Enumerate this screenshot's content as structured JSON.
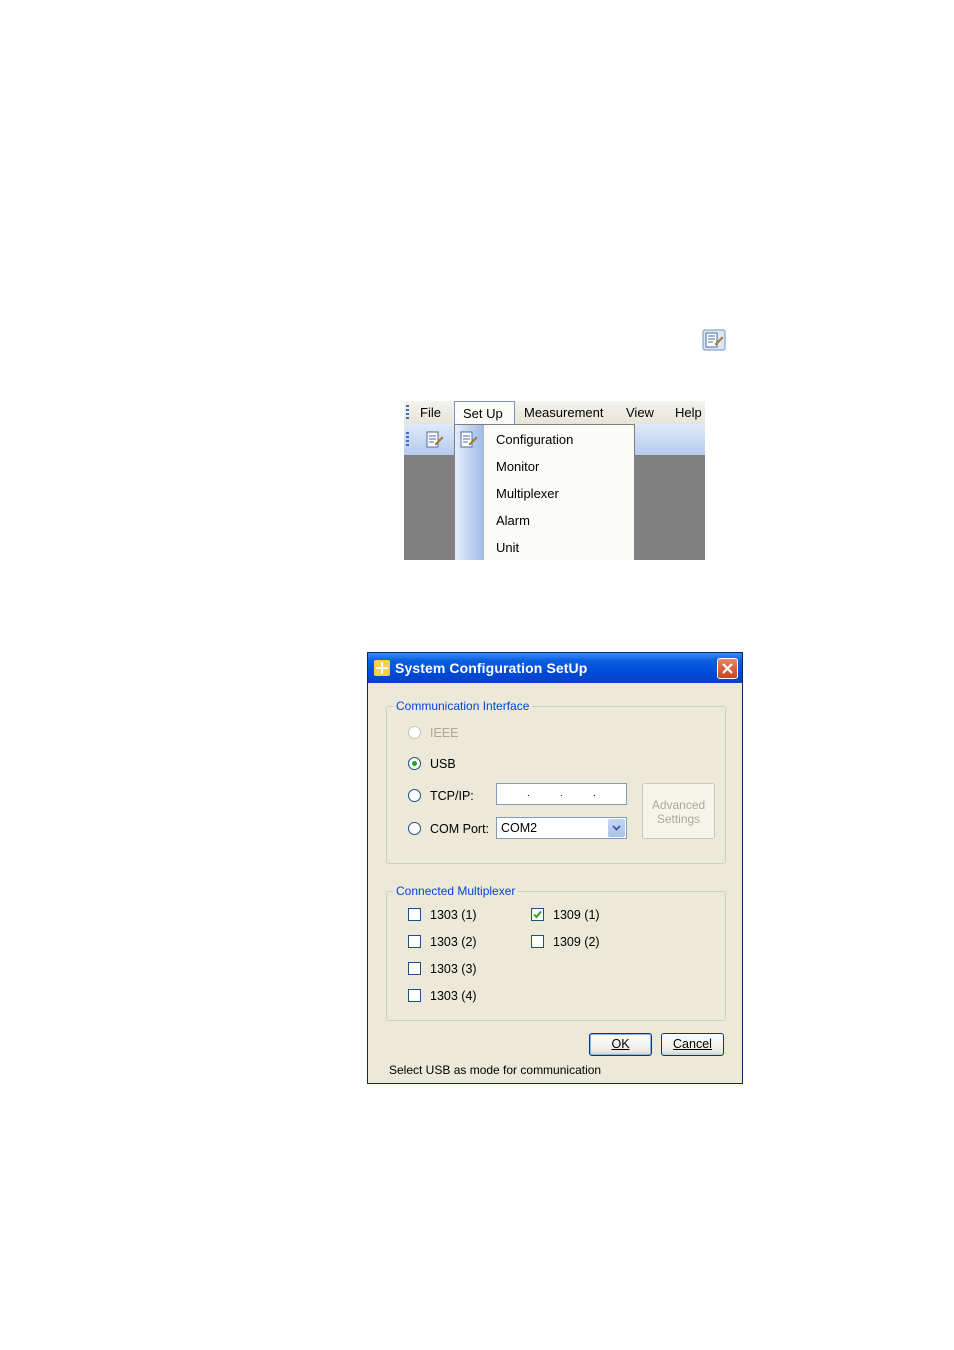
{
  "menu": {
    "bar_items": [
      "File",
      "Set Up",
      "Measurement",
      "View",
      "Help"
    ],
    "open_menu": "Set Up",
    "dropdown_items": [
      "Configuration",
      "Monitor",
      "Multiplexer",
      "Alarm",
      "Unit"
    ],
    "icon": "configuration-icon"
  },
  "dialog": {
    "title": "System Configuration SetUp",
    "comm": {
      "legend": "Communication Interface",
      "ieee": "IEEE",
      "usb": "USB",
      "tcpip": "TCP/IP:",
      "com_port": "COM Port:",
      "selected": "USB",
      "ieee_disabled": true,
      "com_value": "COM2",
      "ip_placeholder": ". . ."
    },
    "advanced": {
      "line1": "Advanced",
      "line2": "Settings",
      "enabled": false
    },
    "mux": {
      "legend": "Connected Multiplexer",
      "items": [
        {
          "label": "1303 (1)",
          "checked": false
        },
        {
          "label": "1303 (2)",
          "checked": false
        },
        {
          "label": "1303 (3)",
          "checked": false
        },
        {
          "label": "1303 (4)",
          "checked": false
        },
        {
          "label": "1309 (1)",
          "checked": true
        },
        {
          "label": "1309 (2)",
          "checked": false
        }
      ]
    },
    "ok": "OK",
    "cancel": "Cancel",
    "status": "Select USB as mode for communication"
  },
  "colors": {
    "title_bar": "#0048d8",
    "legend_text": "#0046d5",
    "dialog_bg": "#ece9d8",
    "radio_selected": "#21a121"
  }
}
